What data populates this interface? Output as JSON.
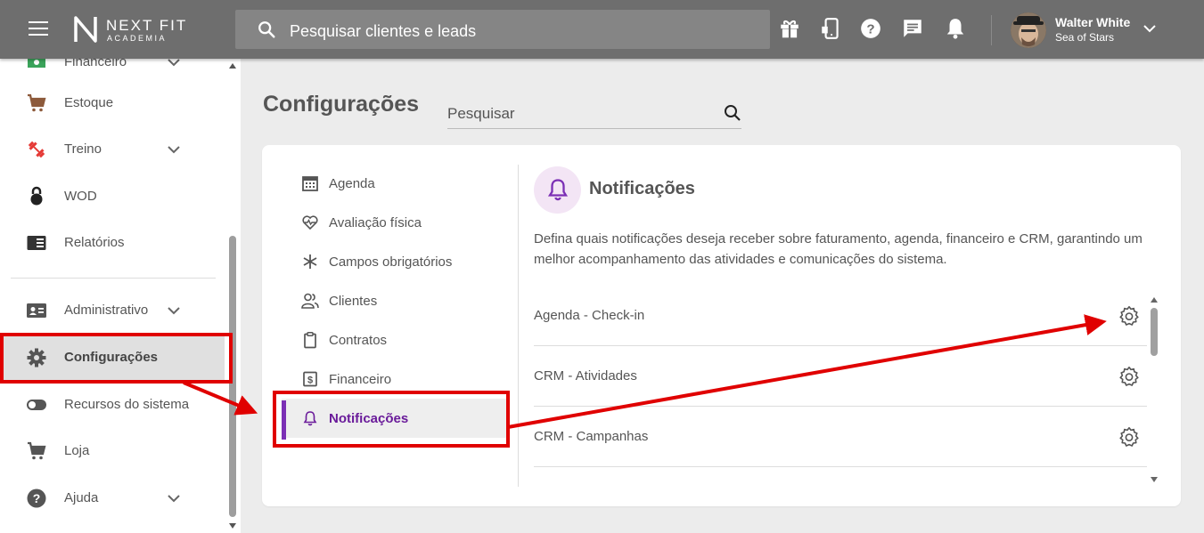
{
  "header": {
    "logo_text": "NEXT FIT",
    "logo_sub": "ACADEMIA",
    "search_placeholder": "Pesquisar clientes e leads",
    "user_name": "Walter White",
    "user_org": "Sea of Stars",
    "icons": [
      "menu-icon",
      "gift-icon",
      "mobile-icon",
      "help-icon",
      "chat-icon",
      "bell-icon",
      "chevron-down-icon"
    ]
  },
  "sidebar": {
    "items": [
      {
        "label": "Financeiro",
        "icon": "cash-icon",
        "has_chevron": true
      },
      {
        "label": "Estoque",
        "icon": "cart-icon",
        "has_chevron": false
      },
      {
        "label": "Treino",
        "icon": "dumbbell-icon",
        "has_chevron": true
      },
      {
        "label": "WOD",
        "icon": "kettlebell-icon",
        "has_chevron": false
      },
      {
        "label": "Relatórios",
        "icon": "report-icon",
        "has_chevron": false
      },
      {
        "label": "Administrativo",
        "icon": "id-card-icon",
        "has_chevron": true
      },
      {
        "label": "Configurações",
        "icon": "gear-icon",
        "has_chevron": false
      },
      {
        "label": "Recursos do sistema",
        "icon": "toggle-icon",
        "has_chevron": false
      },
      {
        "label": "Loja",
        "icon": "cart-icon",
        "has_chevron": false
      },
      {
        "label": "Ajuda",
        "icon": "help-icon",
        "has_chevron": true
      }
    ]
  },
  "main": {
    "title": "Configurações",
    "search_placeholder": "Pesquisar",
    "menu": [
      {
        "label": "Agenda",
        "icon": "calendar-icon"
      },
      {
        "label": "Avaliação física",
        "icon": "heart-pulse-icon"
      },
      {
        "label": "Campos obrigatórios",
        "icon": "asterisk-icon"
      },
      {
        "label": "Clientes",
        "icon": "users-icon"
      },
      {
        "label": "Contratos",
        "icon": "clipboard-icon"
      },
      {
        "label": "Financeiro",
        "icon": "dollar-icon"
      },
      {
        "label": "Notificações",
        "icon": "bell-icon"
      }
    ],
    "section": {
      "title": "Notificações",
      "description": "Defina quais notificações deseja receber sobre faturamento, agenda, financeiro e CRM, garantindo um melhor acompanhamento das atividades e comunicações do sistema.",
      "rows": [
        "Agenda - Check-in",
        "CRM - Atividades",
        "CRM - Campanhas"
      ]
    }
  },
  "colors": {
    "topbar": "#6e6e6e",
    "accent": "#7b2fb5",
    "annotation": "#e00000"
  }
}
